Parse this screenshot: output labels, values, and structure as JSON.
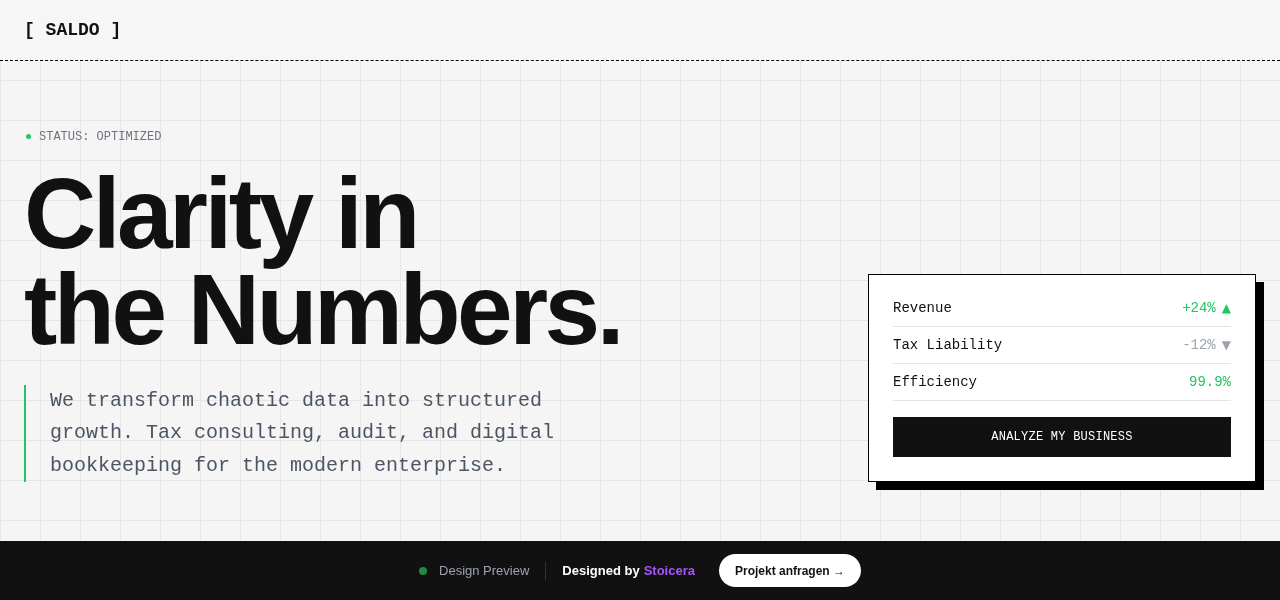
{
  "header": {
    "logo": "[ SALDO ]"
  },
  "hero": {
    "status": "STATUS: OPTIMIZED",
    "headline_lines": [
      "Clarity in",
      "the Numbers."
    ],
    "description": "We transform chaotic data into structured growth. Tax consulting, audit, and digital bookkeeping for the modern enterprise."
  },
  "metrics_card": {
    "metrics": [
      {
        "label": "Revenue",
        "value": "+24%",
        "highlighted": true,
        "arrow": "▲"
      },
      {
        "label": "Tax Liability",
        "value": "-12%",
        "highlighted": false,
        "arrow": "▼"
      },
      {
        "label": "Efficiency",
        "value": "99.9%",
        "highlighted": true
      }
    ],
    "button": "ANALYZE MY BUSINESS"
  },
  "footer": {
    "preview_label": "Design Preview",
    "credit_label": "Designed by",
    "credit_author": "Stoicera",
    "button": "Projekt anfragen →"
  }
}
